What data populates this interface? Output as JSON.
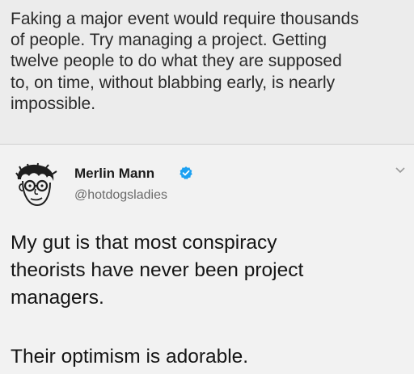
{
  "caption": {
    "text": "Faking a major event would require thousands\nof people.  Try managing a project.  Getting\ntwelve people to do what they are supposed\nto, on time, without blabbing early, is nearly\nimpossible."
  },
  "tweet": {
    "author": {
      "name": "Merlin Mann",
      "handle": "@hotdogsladies",
      "verified": true,
      "avatar_icon": "cartoon-portrait-avatar"
    },
    "menu_icon": "chevron-down-icon",
    "verified_color": "#1da1f2",
    "body_paragraph_1": "My gut is that most conspiracy\ntheorists have never been project\nmanagers.",
    "body_paragraph_2": "Their optimism is adorable."
  }
}
